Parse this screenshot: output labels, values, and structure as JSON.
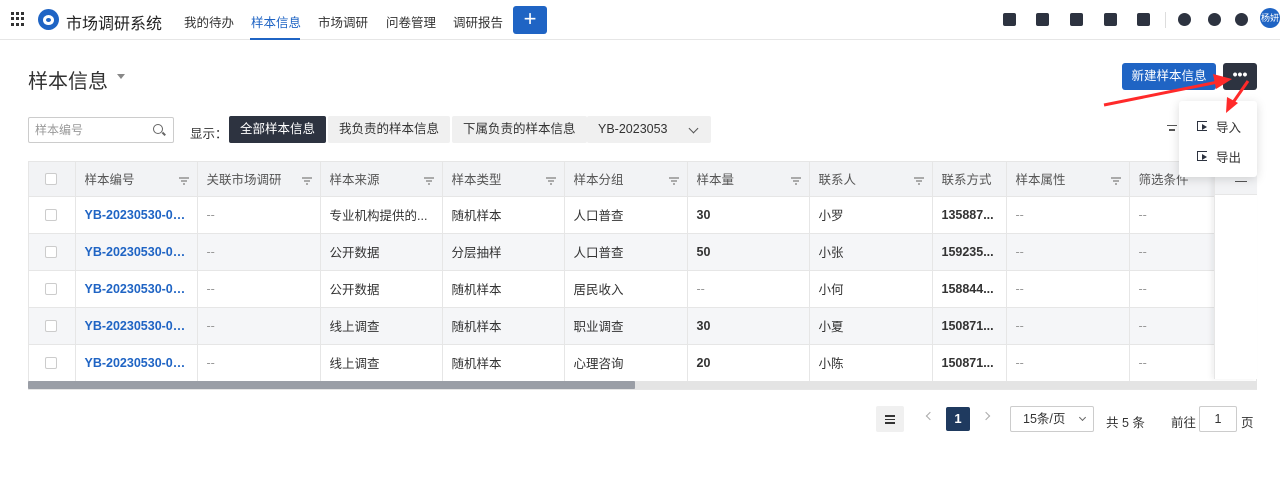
{
  "app": {
    "title": "市场调研系统",
    "avatar_text": "杨妍"
  },
  "nav": {
    "items": [
      {
        "label": "我的待办",
        "active": false
      },
      {
        "label": "样本信息",
        "active": true
      },
      {
        "label": "市场调研",
        "active": false
      },
      {
        "label": "问卷管理",
        "active": false
      },
      {
        "label": "调研报告",
        "active": false
      }
    ],
    "plus_label": "+"
  },
  "toolbar_icons": [
    "task-check-icon",
    "user-icon",
    "document-icon",
    "phone-icon",
    "calendar-icon",
    "bell-icon",
    "help-icon",
    "gear-icon"
  ],
  "page": {
    "title": "样本信息",
    "new_button": "新建样本信息",
    "more_button": "•••"
  },
  "dropdown": {
    "items": [
      {
        "label": "导入",
        "icon": "import-icon"
      },
      {
        "label": "导出",
        "icon": "export-icon"
      }
    ]
  },
  "filters": {
    "search_placeholder": "样本编号",
    "show_label": "显示：",
    "chips": [
      "全部样本信息",
      "我负责的样本信息",
      "下属负责的样本信息",
      "YB-2023053"
    ],
    "active_chip": 0
  },
  "table": {
    "columns": [
      "样本编号",
      "关联市场调研",
      "样本来源",
      "样本类型",
      "样本分组",
      "样本量",
      "联系人",
      "联系方式",
      "样本属性",
      "筛选条件"
    ],
    "rows": [
      [
        "YB-20230530-00...",
        "--",
        "专业机构提供的...",
        "随机样本",
        "人口普查",
        "30",
        "小罗",
        "135887...",
        "--",
        "--"
      ],
      [
        "YB-20230530-00...",
        "--",
        "公开数据",
        "分层抽样",
        "人口普查",
        "50",
        "小张",
        "159235...",
        "--",
        "--"
      ],
      [
        "YB-20230530-00...",
        "--",
        "公开数据",
        "随机样本",
        "居民收入",
        "--",
        "小何",
        "158844...",
        "--",
        "--"
      ],
      [
        "YB-20230530-00...",
        "--",
        "线上调查",
        "随机样本",
        "职业调查",
        "30",
        "小夏",
        "150871...",
        "--",
        "--"
      ],
      [
        "YB-20230530-00...",
        "--",
        "线上调查",
        "随机样本",
        "心理咨询",
        "20",
        "小陈",
        "150871...",
        "--",
        "--"
      ]
    ]
  },
  "pagination": {
    "current_page": "1",
    "page_size": "15条/页",
    "total": "共 5 条",
    "goto_prefix": "前往",
    "goto_value": "1",
    "goto_suffix": "页"
  },
  "colors": {
    "primary": "#1f64c4",
    "dark": "#2d3340",
    "annotation_arrow": "#ff2a2a"
  }
}
